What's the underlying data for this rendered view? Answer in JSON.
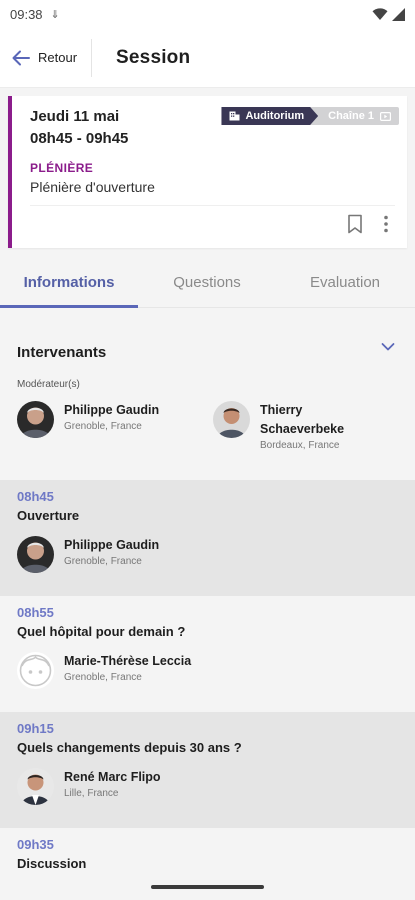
{
  "status_bar": {
    "time": "09:38",
    "download_glyph": "⇓"
  },
  "header": {
    "back_label": "Retour",
    "title": "Session"
  },
  "session": {
    "date": "Jeudi 11 mai",
    "time": "08h45 - 09h45",
    "room": "Auditorium",
    "channel": "Chaîne 1",
    "type": "PLÉNIÈRE",
    "name": "Plénière d'ouverture"
  },
  "tabs": [
    {
      "label": "Informations",
      "active": true
    },
    {
      "label": "Questions",
      "active": false
    },
    {
      "label": "Evaluation",
      "active": false
    }
  ],
  "speakers": {
    "title": "Intervenants",
    "role": "Modérateur(s)",
    "moderators": [
      {
        "name": "Philippe Gaudin",
        "location": "Grenoble, France"
      },
      {
        "name_line1": "Thierry",
        "name_line2": "Schaeverbeke",
        "location": "Bordeaux, France"
      }
    ]
  },
  "agenda": [
    {
      "time": "08h45",
      "title": "Ouverture",
      "speaker": "Philippe Gaudin",
      "location": "Grenoble, France"
    },
    {
      "time": "08h55",
      "title": "Quel hôpital pour demain ?",
      "speaker": "Marie-Thérèse Leccia",
      "location": "Grenoble, France"
    },
    {
      "time": "09h15",
      "title": "Quels changements depuis 30 ans ?",
      "speaker": "René Marc Flipo",
      "location": "Lille, France"
    },
    {
      "time": "09h35",
      "title": "Discussion"
    }
  ],
  "colors": {
    "accent": "#5a67b8",
    "pleniere": "#8b1c8b",
    "room_badge": "#3a3755",
    "channel_badge": "#d2d2d4",
    "highlight_row": "#e5e5e5",
    "row": "#f4f4f4"
  },
  "icons": {
    "back": "arrow-left-icon",
    "room": "building-icon",
    "channel": "video-icon",
    "bookmark": "bookmark-icon",
    "more": "more-vertical-icon",
    "collapse": "chevron-down-icon",
    "placeholder_avatar": "user-placeholder-icon"
  }
}
